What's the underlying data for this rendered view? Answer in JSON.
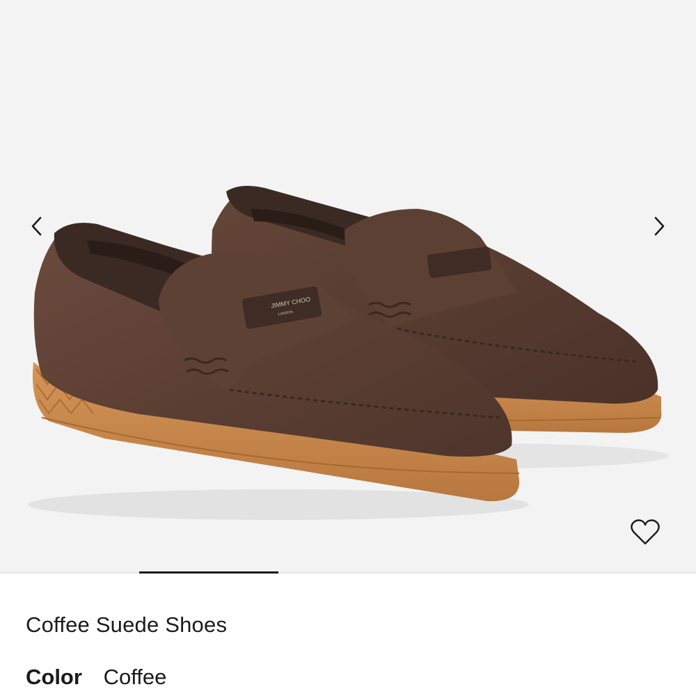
{
  "product": {
    "title": "Coffee Suede Shoes",
    "color_label": "Color",
    "color_value": "Coffee",
    "logo_text": "JIMMY CHOO",
    "logo_subtext": "LONDON"
  },
  "gallery": {
    "icons": {
      "prev": "chevron-left-icon",
      "next": "chevron-right-icon",
      "wishlist": "heart-outline-icon"
    },
    "current_slide": 2,
    "total_slides": 5
  },
  "colors": {
    "background": "#f3f3f3",
    "suede": "#5a3e33",
    "leather_trim": "#3b2a24",
    "sole": "#c98a4f",
    "text": "#1a1a1a"
  }
}
